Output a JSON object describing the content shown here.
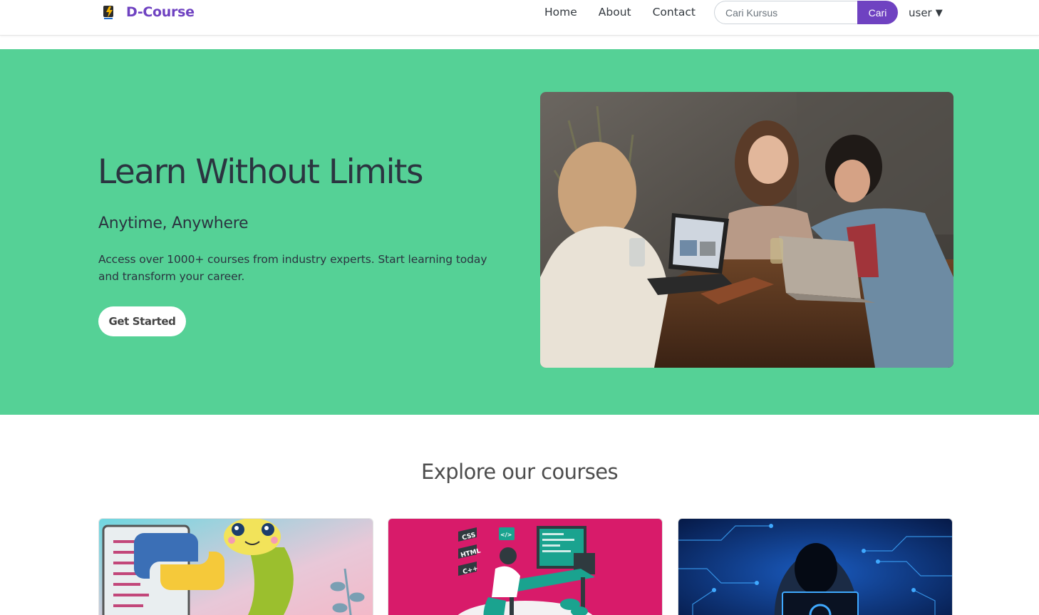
{
  "navbar": {
    "brand": "D-Course",
    "links": [
      "Home",
      "About",
      "Contact"
    ],
    "search": {
      "placeholder": "Cari Kursus",
      "button_label": "Cari"
    },
    "user_label": "user",
    "user_caret": "▼"
  },
  "hero": {
    "title": "Learn Without Limits",
    "subtitle": "Anytime, Anywhere",
    "description": "Access over 1000+ courses from industry experts. Start learning today and transform your career.",
    "cta_label": "Get Started"
  },
  "courses": {
    "title": "Explore our courses",
    "cards": [
      {
        "image": "python-snake-illustration",
        "labels": []
      },
      {
        "image": "web-developer-illustration",
        "labels": [
          "CSS",
          "HTML",
          "C++",
          "</>"
        ]
      },
      {
        "image": "cybersecurity-hacker-photo",
        "labels": []
      }
    ]
  },
  "colors": {
    "brand": "#6f42c1",
    "hero_bg": "#55d196",
    "card2_bg": "#d81b6a",
    "card3_bg": "#0b2a6b"
  }
}
